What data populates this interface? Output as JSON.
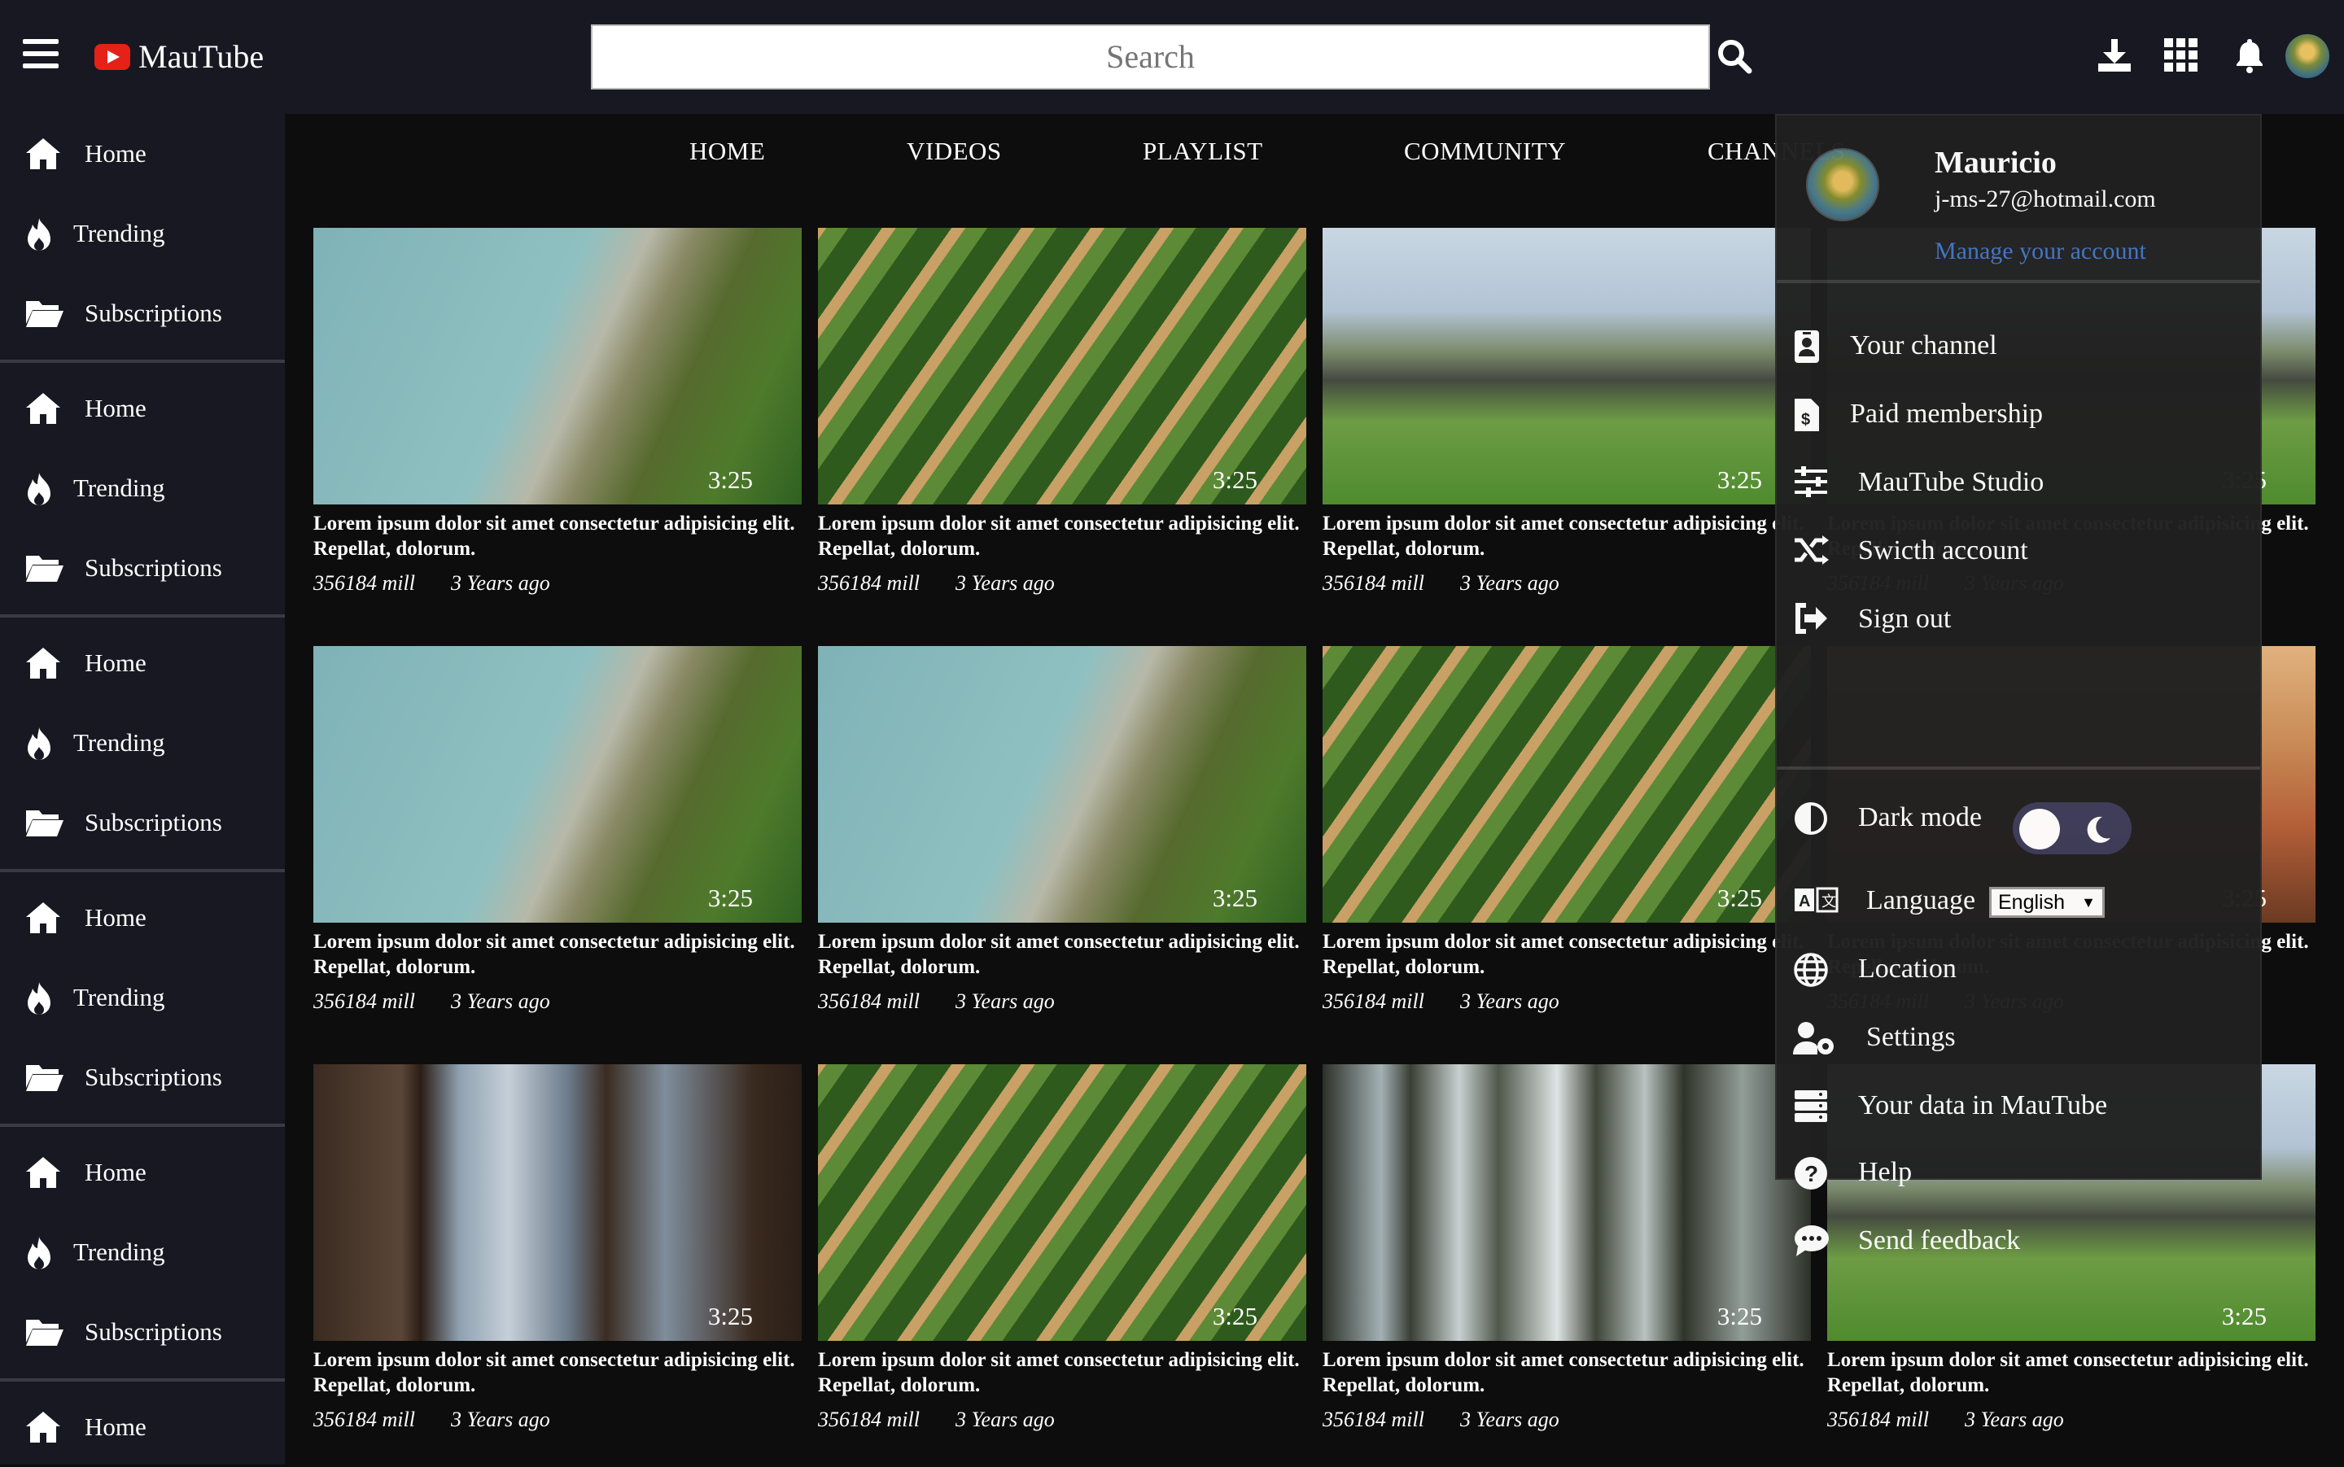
{
  "app": {
    "name": "MauTube"
  },
  "search": {
    "placeholder": "Search"
  },
  "sidebar": {
    "groups": [
      [
        {
          "icon": "home-icon",
          "label": "Home"
        },
        {
          "icon": "fire-icon",
          "label": "Trending"
        },
        {
          "icon": "folder-icon",
          "label": "Subscriptions"
        }
      ],
      [
        {
          "icon": "home-icon",
          "label": "Home"
        },
        {
          "icon": "fire-icon",
          "label": "Trending"
        },
        {
          "icon": "folder-icon",
          "label": "Subscriptions"
        }
      ],
      [
        {
          "icon": "home-icon",
          "label": "Home"
        },
        {
          "icon": "fire-icon",
          "label": "Trending"
        },
        {
          "icon": "folder-icon",
          "label": "Subscriptions"
        }
      ],
      [
        {
          "icon": "home-icon",
          "label": "Home"
        },
        {
          "icon": "fire-icon",
          "label": "Trending"
        },
        {
          "icon": "folder-icon",
          "label": "Subscriptions"
        }
      ],
      [
        {
          "icon": "home-icon",
          "label": "Home"
        },
        {
          "icon": "fire-icon",
          "label": "Trending"
        },
        {
          "icon": "folder-icon",
          "label": "Subscriptions"
        }
      ],
      [
        {
          "icon": "home-icon",
          "label": "Home"
        }
      ]
    ]
  },
  "tabs": [
    "HOME",
    "VIDEOS",
    "PLAYLIST",
    "COMMUNITY",
    "CHANNELS"
  ],
  "videos": [
    {
      "thumb": "cliff",
      "duration": "3:25",
      "title": "Lorem ipsum dolor sit amet consectetur adipisicing elit. Repellat, dolorum.",
      "views": "356184 mill",
      "age": "3 Years ago"
    },
    {
      "thumb": "field",
      "duration": "3:25",
      "title": "Lorem ipsum dolor sit amet consectetur adipisicing elit. Repellat, dolorum.",
      "views": "356184 mill",
      "age": "3 Years ago"
    },
    {
      "thumb": "rocks",
      "duration": "3:25",
      "title": "Lorem ipsum dolor sit amet consectetur adipisicing elit. Repellat, dolorum.",
      "views": "356184 mill",
      "age": "3 Years ago"
    },
    {
      "thumb": "rocks",
      "duration": "3:25",
      "title": "Lorem ipsum dolor sit amet consectetur adipisicing elit. Repellat, dolorum.",
      "views": "356184 mill",
      "age": "3 Years ago"
    },
    {
      "thumb": "cliff",
      "duration": "3:25",
      "title": "Lorem ipsum dolor sit amet consectetur adipisicing elit. Repellat, dolorum.",
      "views": "356184 mill",
      "age": "3 Years ago"
    },
    {
      "thumb": "cliff",
      "duration": "3:25",
      "title": "Lorem ipsum dolor sit amet consectetur adipisicing elit. Repellat, dolorum.",
      "views": "356184 mill",
      "age": "3 Years ago"
    },
    {
      "thumb": "field",
      "duration": "3:25",
      "title": "Lorem ipsum dolor sit amet consectetur adipisicing elit. Repellat, dolorum.",
      "views": "356184 mill",
      "age": "3 Years ago"
    },
    {
      "thumb": "sunset",
      "duration": "3:25",
      "title": "Lorem ipsum dolor sit amet consectetur adipisicing elit. Repellat, dolorum.",
      "views": "356184 mill",
      "age": "3 Years ago"
    },
    {
      "thumb": "window",
      "duration": "3:25",
      "title": "Lorem ipsum dolor sit amet consectetur adipisicing elit. Repellat, dolorum.",
      "views": "356184 mill",
      "age": "3 Years ago"
    },
    {
      "thumb": "field",
      "duration": "3:25",
      "title": "Lorem ipsum dolor sit amet consectetur adipisicing elit. Repellat, dolorum.",
      "views": "356184 mill",
      "age": "3 Years ago"
    },
    {
      "thumb": "forest",
      "duration": "3:25",
      "title": "Lorem ipsum dolor sit amet consectetur adipisicing elit. Repellat, dolorum.",
      "views": "356184 mill",
      "age": "3 Years ago"
    },
    {
      "thumb": "rocks",
      "duration": "3:25",
      "title": "Lorem ipsum dolor sit amet consectetur adipisicing elit. Repellat, dolorum.",
      "views": "356184 mill",
      "age": "3 Years ago"
    }
  ],
  "account_menu": {
    "name": "Mauricio",
    "email": "j-ms-27@hotmail.com",
    "manage_link": "Manage your account",
    "items": [
      {
        "icon": "id-badge-icon",
        "label": "Your channel"
      },
      {
        "icon": "invoice-dollar-icon",
        "label": "Paid membership"
      },
      {
        "icon": "sliders-icon",
        "label": "MauTube Studio"
      },
      {
        "icon": "shuffle-icon",
        "label": "Swicth account"
      },
      {
        "icon": "sign-out-icon",
        "label": "Sign out"
      }
    ],
    "settings": {
      "dark_mode_label": "Dark mode",
      "dark_mode_on": false,
      "language_label": "Language",
      "language_value": "English",
      "items": [
        {
          "icon": "globe-icon",
          "label": "Location"
        },
        {
          "icon": "user-cog-icon",
          "label": "Settings"
        },
        {
          "icon": "server-icon",
          "label": "Your data in MauTube"
        },
        {
          "icon": "question-circle-icon",
          "label": "Help"
        },
        {
          "icon": "comment-dots-icon",
          "label": "Send feedback"
        }
      ]
    }
  },
  "colors": {
    "header_bg": "#181822",
    "page_bg": "#0d0d0d",
    "brand_red": "#e62117",
    "link_blue": "#3e74c2"
  }
}
